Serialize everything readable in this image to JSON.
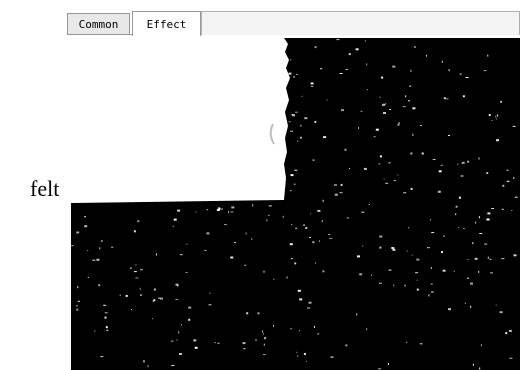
{
  "side_label": "felt",
  "tabs": [
    {
      "label": "Common",
      "selected": false
    },
    {
      "label": "Effect",
      "selected": true
    }
  ],
  "preview": {
    "background_color": "#000000",
    "shape_color": "#ffffff"
  }
}
